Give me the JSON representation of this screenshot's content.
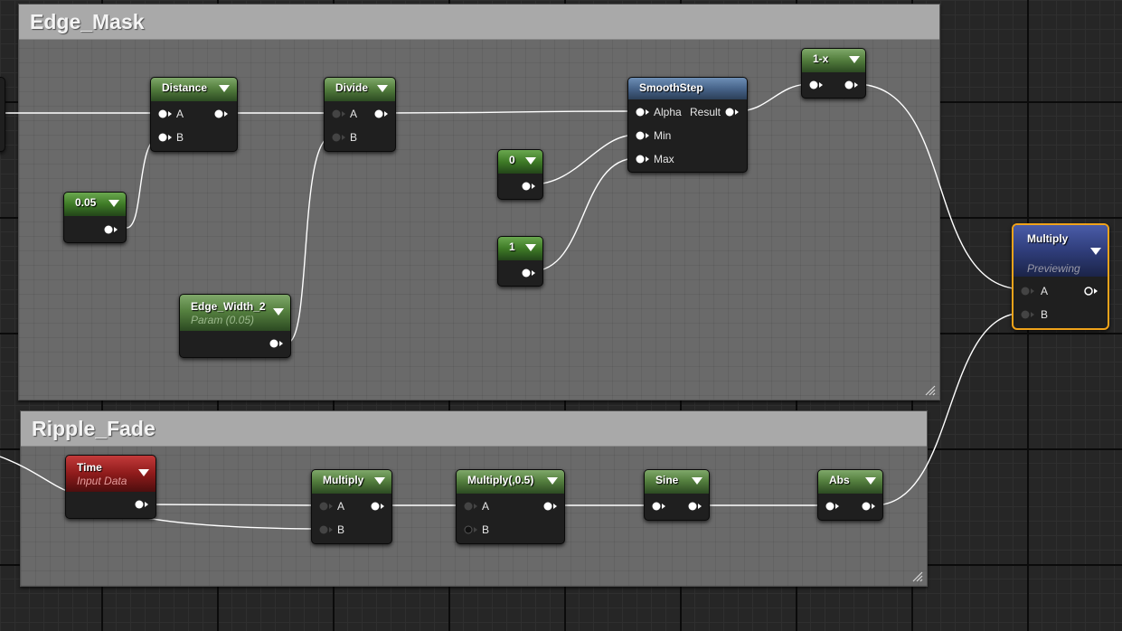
{
  "comments": {
    "edge_mask": "Edge_Mask",
    "ripple_fade": "Ripple_Fade"
  },
  "nodes": {
    "distance": {
      "title": "Distance",
      "pins": [
        "A",
        "B"
      ]
    },
    "divide": {
      "title": "Divide",
      "pins": [
        "A",
        "B"
      ]
    },
    "const_005": {
      "title": "0.05"
    },
    "edge_width": {
      "title": "Edge_Width_2",
      "subtitle": "Param (0.05)"
    },
    "const_0": {
      "title": "0"
    },
    "const_1": {
      "title": "1"
    },
    "smoothstep": {
      "title": "SmoothStep",
      "pins": [
        "Alpha",
        "Min",
        "Max"
      ],
      "output": "Result"
    },
    "one_minus_x": {
      "title": "1-x"
    },
    "multiply_out": {
      "title": "Multiply",
      "subtitle": "Previewing",
      "pins": [
        "A",
        "B"
      ]
    },
    "time": {
      "title": "Time",
      "subtitle": "Input Data"
    },
    "multiply_ripple": {
      "title": "Multiply",
      "pins": [
        "A",
        "B"
      ]
    },
    "multiply_half": {
      "title": "Multiply(,0.5)",
      "pins": [
        "A",
        "B"
      ]
    },
    "sine": {
      "title": "Sine"
    },
    "abs": {
      "title": "Abs"
    }
  },
  "colors": {
    "comment_bar": "#a9a9a9",
    "comment_body": "#6a6a6a",
    "selection": "#f0a31a",
    "wire": "#ffffff",
    "graph_bg": "#262626"
  }
}
